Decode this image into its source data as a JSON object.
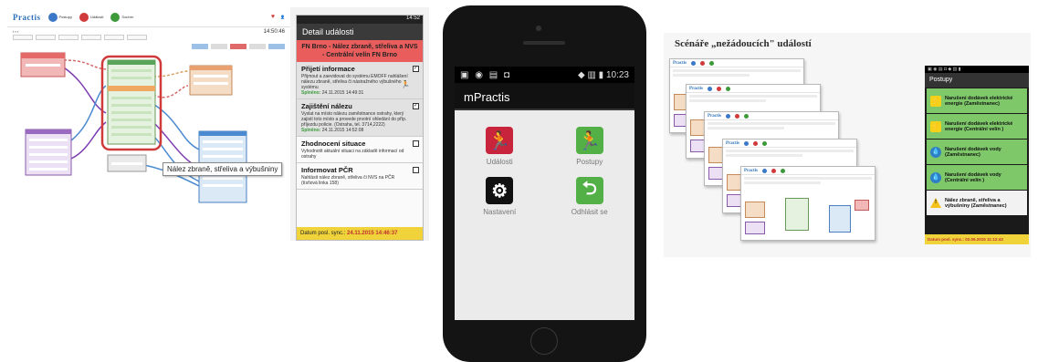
{
  "panel1": {
    "logo": "Practis",
    "top_icons": [
      "Postupy",
      "Události",
      "Souhrn"
    ],
    "clock": "14:50:46",
    "tooltip": "Nález zbraně, střeliva a výbušniny",
    "detail": {
      "status_bar": "14:52",
      "header": "Detail události",
      "alert": "FN Brno - Nález zbraně, střeliva a NVS - Centrální velín FN Brno",
      "items": [
        {
          "title": "Přijetí informace",
          "body": "Přijmout a zaevidovat do systému EMOFF nahlášení nálezu zbraně, střeliva či nástražného výbušného systému",
          "done_label": "Splněno:",
          "done_time": "24.11.2015 14:49:31",
          "checked": true
        },
        {
          "title": "Zajištění nálezu",
          "body": "Vyslat na místo nálezu zaměstnance ostrahy, který zajistí toto místo a provede prvotní ohledání do příp. příjezdu policie. (Ostraha, tel. 3714,2222)",
          "done_label": "Splněno:",
          "done_time": "24.11.2015 14:52:08",
          "checked": true
        },
        {
          "title": "Zhodnocení situace",
          "body": "Vyhodnotit aktuální situaci na základě informací od ostrahy",
          "done_label": "",
          "done_time": "",
          "checked": false
        },
        {
          "title": "Informovat PČR",
          "body": "Nahlásit nález zbraně, střeliva či NVS na PČR (tísňová linka 158)",
          "done_label": "",
          "done_time": "",
          "checked": false
        }
      ],
      "footer_label": "Datum posl. sync.:",
      "footer_value": "24.11.2015 14:46:37"
    }
  },
  "panel2": {
    "status_time": "10:23",
    "app_title": "mPractis",
    "tiles": [
      {
        "label": "Události",
        "icon": "runner-icon",
        "glyph": "🏃",
        "color": "#c8253c"
      },
      {
        "label": "Postupy",
        "icon": "runner-icon",
        "glyph": "🏃",
        "color": "#53b047"
      },
      {
        "label": "Nastavení",
        "icon": "gears-icon",
        "glyph": "⚙",
        "color": "#111111"
      },
      {
        "label": "Odhlásit se",
        "icon": "logout-icon",
        "glyph": "⮌",
        "color": "#53b047"
      }
    ]
  },
  "panel3": {
    "title": "Scénáře „nežádoucích\" událostí",
    "phone": {
      "header": "Postupy",
      "items": [
        {
          "label": "Narušení dodávek elektrické energie (Zaměstnanec)",
          "icon": "bolt-icon",
          "glyph": "⚡",
          "bg": "green"
        },
        {
          "label": "Narušení dodávek elektrické energie (Centrální velín )",
          "icon": "bolt-icon",
          "glyph": "⚡",
          "bg": "green"
        },
        {
          "label": "Narušení dodávek vody (Zaměstnanec)",
          "icon": "water-icon",
          "glyph": "💧",
          "bg": "green"
        },
        {
          "label": "Narušení dodávek vody (Centrální velín )",
          "icon": "water-icon",
          "glyph": "💧",
          "bg": "green"
        },
        {
          "label": "Nález zbraně, střeliva a výbušniny (Zaměstnanec)",
          "icon": "warning-icon",
          "glyph": "!",
          "bg": "white"
        }
      ],
      "footer": "Datum posl. sync.: 02.06.2015 11:12:43"
    }
  }
}
